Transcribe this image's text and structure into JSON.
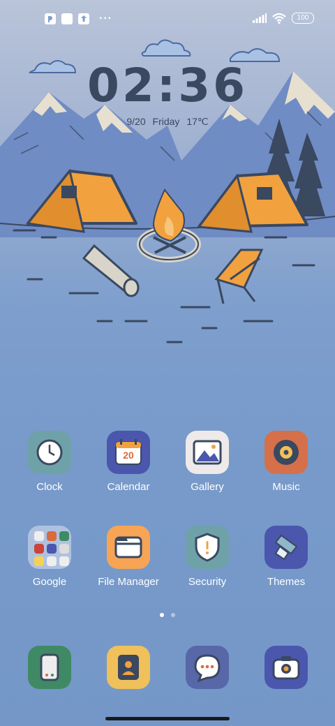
{
  "status_bar": {
    "left_icons": [
      "app-notification-icon",
      "square-notification-icon",
      "upload-notification-icon"
    ],
    "more": "···",
    "battery": "100",
    "right_icons": [
      "signal-icon",
      "wifi-icon",
      "battery-icon"
    ]
  },
  "lockclock": {
    "time": "02:36",
    "date": "9/20 Friday 17℃"
  },
  "apps": {
    "row1": [
      {
        "label": "Clock",
        "icon": "clock-icon",
        "color": "#6fa2a8"
      },
      {
        "label": "Calendar",
        "icon": "calendar-icon",
        "color": "#4a57ad"
      },
      {
        "label": "Gallery",
        "icon": "gallery-icon",
        "color": "#eeeaea"
      },
      {
        "label": "Music",
        "icon": "music-icon",
        "color": "#d5704a"
      }
    ],
    "row2": [
      {
        "label": "Google",
        "icon": "google-folder-icon"
      },
      {
        "label": "File Manager",
        "icon": "file-manager-icon",
        "color": "#f7a455"
      },
      {
        "label": "Security",
        "icon": "security-icon",
        "color": "#6fa2a8"
      },
      {
        "label": "Themes",
        "icon": "themes-icon",
        "color": "#4a57ad"
      }
    ],
    "calendar_day": "20"
  },
  "page_indicator": {
    "pages": 2,
    "current": 1
  },
  "dock": [
    {
      "name": "phone",
      "icon": "phone-icon",
      "color": "#3f8a64"
    },
    {
      "name": "contacts",
      "icon": "contacts-icon",
      "color": "#f0c05a"
    },
    {
      "name": "messages",
      "icon": "messages-icon",
      "color": "#5867a8"
    },
    {
      "name": "camera",
      "icon": "camera-icon",
      "color": "#4a57ad"
    }
  ]
}
